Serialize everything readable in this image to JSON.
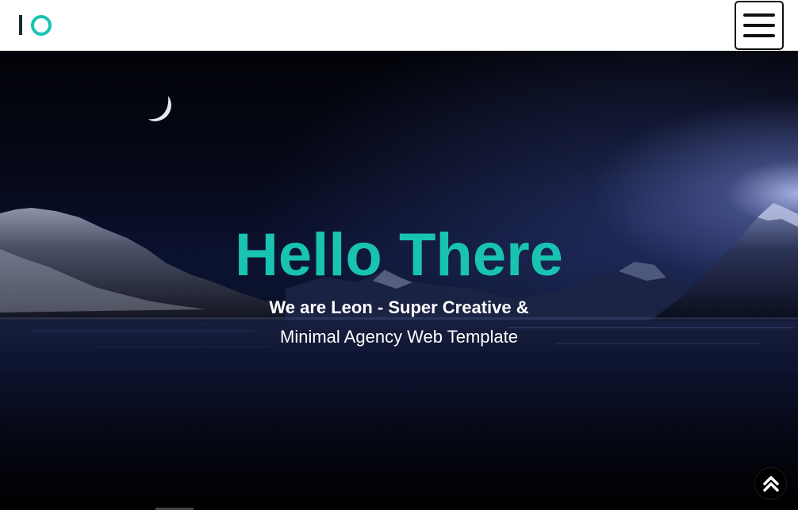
{
  "navbar": {
    "logo_icon": "io-logo-icon",
    "menu_icon": "hamburger-menu-icon"
  },
  "hero": {
    "title": "Hello There",
    "subtitle_line1": "We are Leon - Super Creative &",
    "subtitle_line2": "Minimal Agency Web Template"
  },
  "scroll_top": {
    "icon": "double-chevron-up-icon"
  },
  "colors": {
    "accent": "#19c3b1",
    "navbar_bg": "#ffffff",
    "hero_bg": "#050816"
  }
}
